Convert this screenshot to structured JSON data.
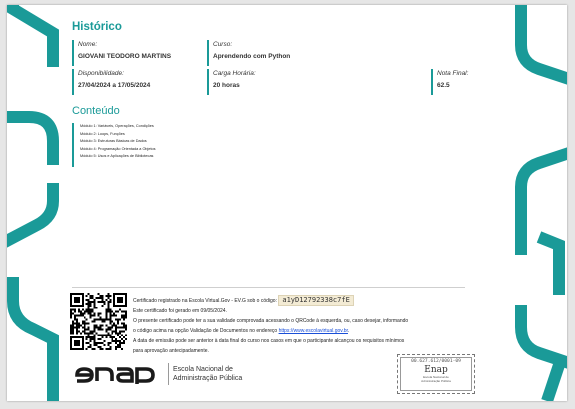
{
  "colors": {
    "accent": "#1a9a98",
    "link": "#1a4fd8",
    "code_bg": "#f3ebd4"
  },
  "historico": {
    "title": "Histórico",
    "nome_label": "Nome:",
    "nome_value": "GIOVANI TEODORO MARTINS",
    "curso_label": "Curso:",
    "curso_value": "Aprendendo com Python",
    "disponibilidade_label": "Disponibilidade:",
    "disponibilidade_value": "27/04/2024 a 17/05/2024",
    "carga_label": "Carga Horária:",
    "carga_value": "20 horas",
    "nota_label": "Nota Final:",
    "nota_value": "62.5"
  },
  "conteudo": {
    "title": "Conteúdo",
    "modules": [
      "Módulo 1: Variáveis, Operações, Condições",
      "Módulo 2: Loops, Funções",
      "Módulo 3: Estruturas Básicas de Dados",
      "Módulo 4: Programação Orientada a Objetos",
      "Módulo 5: Usos e Aplicações de Bibliotecas"
    ]
  },
  "certificate": {
    "registered_text": "Certificado registrado na Escola Virtual.Gov - EV.G sob o código:",
    "code": "a1yD12792338c7fE",
    "generated_text": "Este certificado foi gerado em 09/05/2024.",
    "verify_text": "O presente certificado pode ter a sua validade comprovada acessando o QRCode à esquerda, ou, caso desejar, informando",
    "verify_text2_before": "o código acima na opção Validação de Documentos no endereço",
    "verify_link": "https://www.escolavirtual.gov.br",
    "verify_text2_after": ".",
    "emission_text": "A data de emissão pode ser anterior à data final do curso nos casos em que o participante alcançou os requisitos mínimos",
    "emission_text2": "para aprovação antecipadamente."
  },
  "footer": {
    "logo_word": "enap",
    "institution_line1": "Escola Nacional de",
    "institution_line2": "Administração Pública",
    "stamp_code": "00.627.612/0001-09",
    "stamp_brand": "Enap",
    "stamp_sub1": "Escola Nacional de",
    "stamp_sub2": "Administração Pública"
  }
}
